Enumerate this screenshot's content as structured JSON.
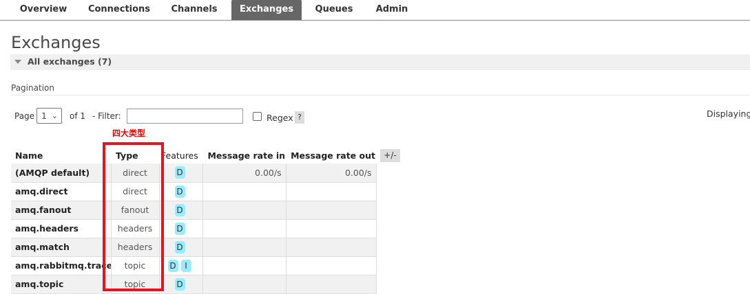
{
  "nav": {
    "tabs": [
      {
        "label": "Overview"
      },
      {
        "label": "Connections"
      },
      {
        "label": "Channels"
      },
      {
        "label": "Exchanges",
        "active": true
      },
      {
        "label": "Queues"
      },
      {
        "label": "Admin"
      }
    ]
  },
  "page": {
    "title": "Exchanges",
    "section": "All exchanges (7)"
  },
  "pagination": {
    "heading": "Pagination",
    "page_label": "Page",
    "page_value": "1",
    "of_label": "of 1",
    "filter_label": "- Filter:",
    "filter_value": "",
    "regex_label": "Regex",
    "help_label": "?",
    "displaying": "Displaying"
  },
  "annotation": "四大类型",
  "table": {
    "columns": [
      "Name",
      "Type",
      "Features",
      "Message rate in",
      "Message rate out"
    ],
    "toggle_label": "+/-",
    "rows": [
      {
        "name": "(AMQP default)",
        "type": "direct",
        "features": [
          "D"
        ],
        "rate_in": "0.00/s",
        "rate_out": "0.00/s"
      },
      {
        "name": "amq.direct",
        "type": "direct",
        "features": [
          "D"
        ],
        "rate_in": "",
        "rate_out": ""
      },
      {
        "name": "amq.fanout",
        "type": "fanout",
        "features": [
          "D"
        ],
        "rate_in": "",
        "rate_out": ""
      },
      {
        "name": "amq.headers",
        "type": "headers",
        "features": [
          "D"
        ],
        "rate_in": "",
        "rate_out": ""
      },
      {
        "name": "amq.match",
        "type": "headers",
        "features": [
          "D"
        ],
        "rate_in": "",
        "rate_out": ""
      },
      {
        "name": "amq.rabbitmq.trace",
        "type": "topic",
        "features": [
          "D",
          "I"
        ],
        "rate_in": "",
        "rate_out": ""
      },
      {
        "name": "amq.topic",
        "type": "topic",
        "features": [
          "D"
        ],
        "rate_in": "",
        "rate_out": ""
      }
    ]
  },
  "colors": {
    "active_tab": "#666666",
    "feature_badge": "#99ebff",
    "highlight_box": "#e8131f",
    "annotation_text": "#ee0000"
  }
}
